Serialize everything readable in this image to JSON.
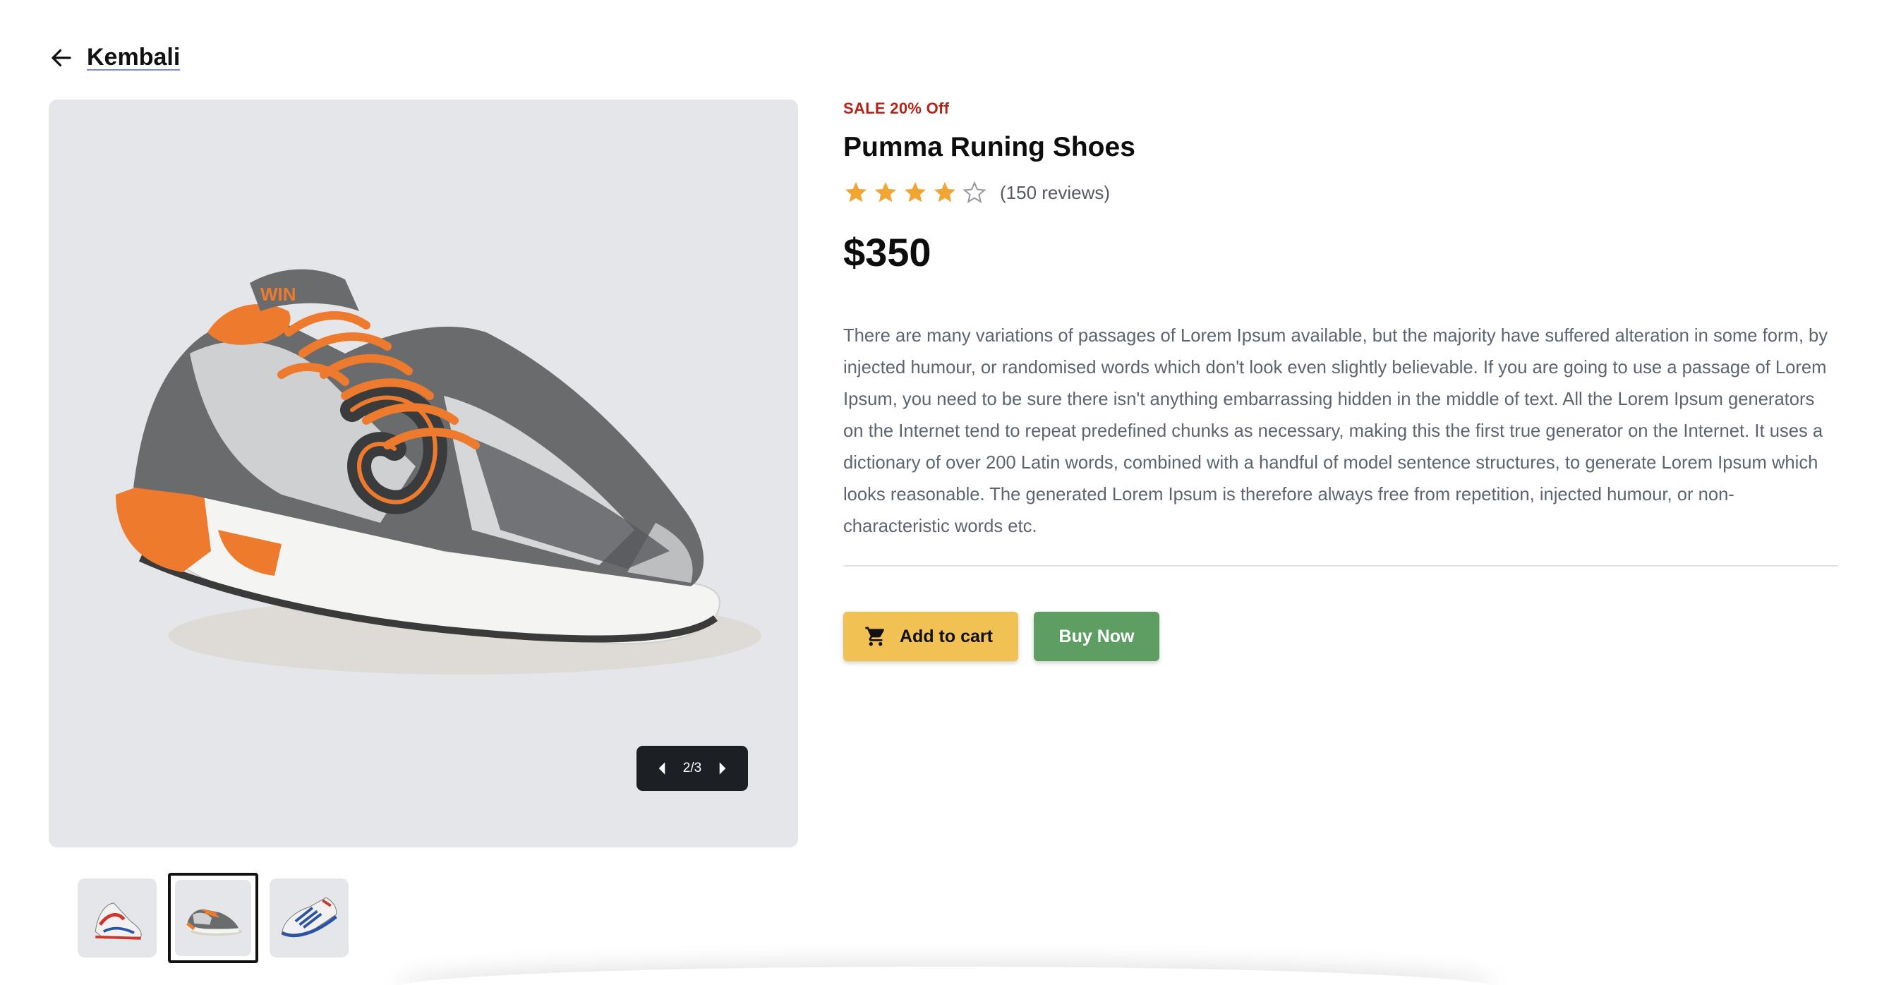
{
  "nav": {
    "back_label": "Kembali",
    "back_icon": "arrow-left-icon"
  },
  "gallery": {
    "counter": "2/3",
    "current_index": 2,
    "total": 3,
    "prev_icon": "caret-left-icon",
    "next_icon": "caret-right-icon",
    "thumbnails": [
      {
        "name": "thumbnail-1",
        "active": false
      },
      {
        "name": "thumbnail-2",
        "active": true
      },
      {
        "name": "thumbnail-3",
        "active": false
      }
    ]
  },
  "product": {
    "sale_badge": "SALE 20% Off",
    "title": "Pumma Runing Shoes",
    "rating": 4,
    "rating_max": 5,
    "reviews": "(150 reviews)",
    "price": "$350",
    "description": "There are many variations of passages of Lorem Ipsum available, but the majority have suffered alteration in some form, by injected humour, or randomised words which don't look even slightly believable. If you are going to use a passage of Lorem Ipsum, you need to be sure there isn't anything embarrassing hidden in the middle of text. All the Lorem Ipsum generators on the Internet tend to repeat predefined chunks as necessary, making this the first true generator on the Internet. It uses a dictionary of over 200 Latin words, combined with a handful of model sentence structures, to generate Lorem Ipsum which looks reasonable. The generated Lorem Ipsum is therefore always free from repetition, injected humour, or non-characteristic words etc."
  },
  "actions": {
    "add_to_cart_label": "Add to cart",
    "add_to_cart_icon": "shopping-cart-icon",
    "buy_now_label": "Buy Now"
  },
  "colors": {
    "sale": "#b42318",
    "star": "#f1a533",
    "add_to_cart_bg": "#f2c153",
    "buy_now_bg": "#5e9e63",
    "gallery_bg": "#e5e6ea",
    "pager_bg": "#1c1f24"
  }
}
